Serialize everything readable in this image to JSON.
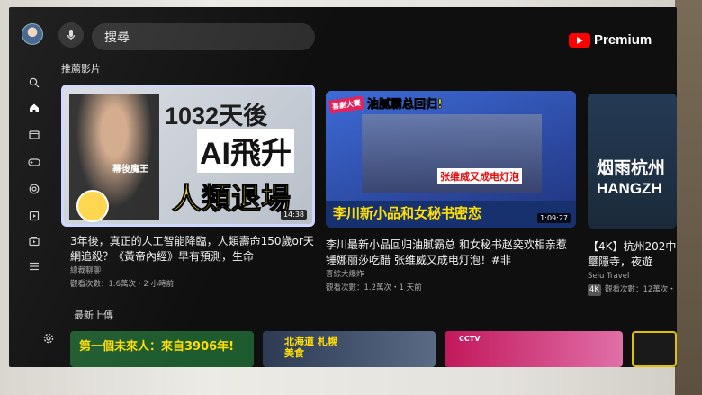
{
  "header": {
    "search_placeholder": "搜尋",
    "brand": "Premium"
  },
  "sections": {
    "recommended": "推薦影片",
    "latest": "最新上傳"
  },
  "videos": [
    {
      "thumb_lines": [
        "1032天後",
        "AI飛升",
        "人類退場"
      ],
      "thumb_tag": "幕後魔王",
      "duration": "14:38",
      "title": "3年後，真正的人工智能降臨，人類壽命150歲or天網追殺？《黃帝內經》早有預測，生命",
      "channel": "總裁聊聊",
      "meta": "觀看次數：1.6萬次・2 小時前"
    },
    {
      "thumb_top": "油腻霸总回归!",
      "thumb_tag": "喜劇大賽",
      "thumb_caption": "张维威又成电灯泡",
      "thumb_bottom": "李川新小品和女秘书密恋",
      "duration": "1:09:27",
      "title": "李川最新小品回归油腻霸总 和女秘书赵奕欢相亲惹锤娜丽莎吃醋 张维威又成电灯泡！#非",
      "channel": "喜綜大爆炸",
      "meta": "觀看次數：1.2萬次・1 天前"
    },
    {
      "thumb_big": "烟雨杭州",
      "thumb_en": "HANGZH",
      "title": "【4K】杭州202中璽隱寺，夜遊",
      "channel": "Seiu Travel",
      "badge": "4K",
      "meta": "觀看次數：12萬次・"
    }
  ],
  "bottom_row": [
    {
      "text": "第一個未來人：來自3906年!"
    },
    {
      "text": "北海道 札幌美食"
    },
    {
      "text": "CCTV"
    }
  ],
  "colors": {
    "accent_red": "#ff0000",
    "focus_border": "#cfd6ff",
    "thumb_yellow": "#ffe000"
  }
}
